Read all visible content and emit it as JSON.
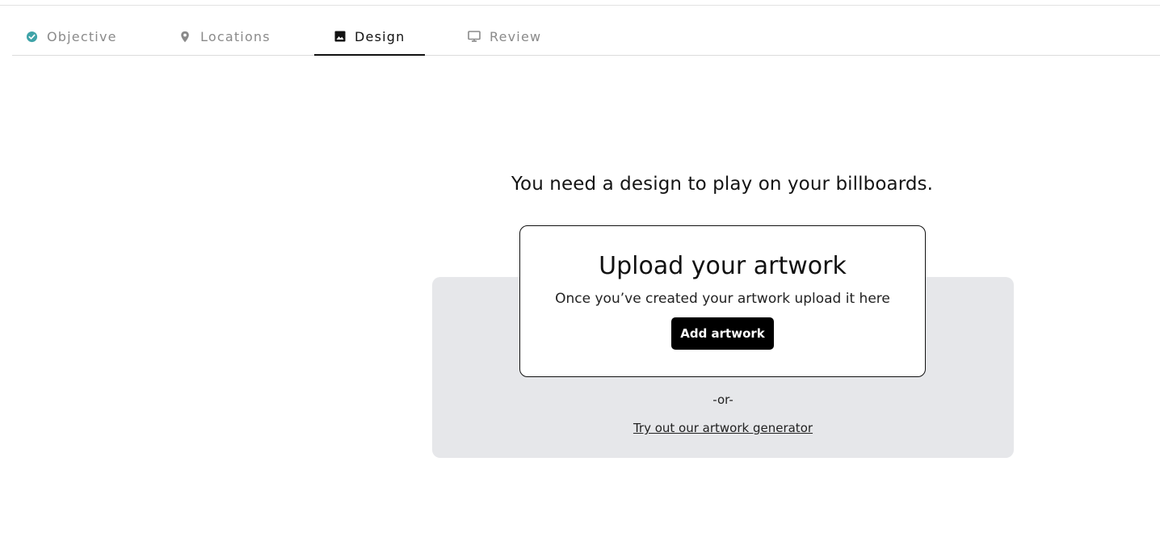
{
  "tabs": [
    {
      "label": "Objective",
      "icon": "check-circle-icon",
      "state": "completed"
    },
    {
      "label": "Locations",
      "icon": "location-pin-icon",
      "state": "inactive"
    },
    {
      "label": "Design",
      "icon": "image-icon",
      "state": "active"
    },
    {
      "label": "Review",
      "icon": "monitor-icon",
      "state": "inactive"
    }
  ],
  "main": {
    "headline": "You need a design to play on your billboards.",
    "upload": {
      "title": "Upload your artwork",
      "subtitle": "Once you’ve created your artwork upload it here",
      "button_label": "Add artwork"
    },
    "or_text": "-or-",
    "generator_link": "Try out our artwork generator"
  },
  "colors": {
    "accent_teal": "#3fa3a8",
    "active_text": "#111111",
    "inactive_text": "#8a8a8a",
    "panel_bg": "#e6e7ea",
    "button_bg": "#000000"
  }
}
